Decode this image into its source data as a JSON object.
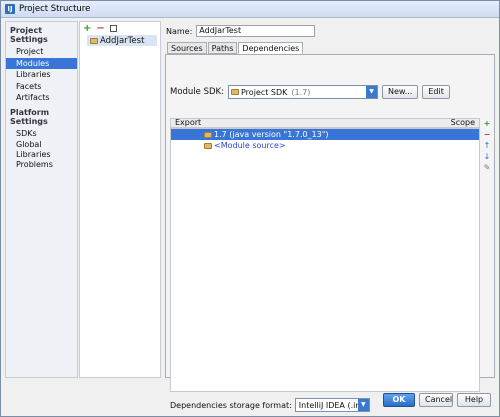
{
  "window": {
    "title": "Project Structure",
    "app_icon": "intellij-icon"
  },
  "nav": {
    "project_settings_header": "Project Settings",
    "project_items": [
      "Project",
      "Modules",
      "Libraries",
      "Facets",
      "Artifacts"
    ],
    "platform_settings_header": "Platform Settings",
    "platform_items": [
      "SDKs",
      "Global Libraries"
    ],
    "other_items": [
      "Problems"
    ],
    "selected": "Modules"
  },
  "modules": {
    "toolbar": {
      "add": "+",
      "remove": "−"
    },
    "items": [
      "AddJarTest"
    ]
  },
  "main": {
    "name_label": "Name:",
    "name_value": "AddJarTest",
    "tabs": [
      "Sources",
      "Paths",
      "Dependencies"
    ],
    "active_tab": "Dependencies",
    "sdk_label": "Module SDK:",
    "sdk_value": "Project SDK",
    "sdk_version": "(1.7)",
    "new_button": "New...",
    "edit_button": "Edit",
    "table_headers": {
      "export": "Export",
      "scope": "Scope"
    },
    "dependencies": [
      {
        "label": "1.7 (java version \"1.7.0_13\")",
        "selected": true
      },
      {
        "label": "<Module source>",
        "selected": false
      }
    ],
    "side_toolbar": {
      "add": "+",
      "remove": "−",
      "up": "↑",
      "down": "↓",
      "edit": "✎"
    },
    "storage_label": "Dependencies storage format:",
    "storage_value": "IntelliJ IDEA (.iml)"
  },
  "footer": {
    "ok": "OK",
    "cancel": "Cancel",
    "help": "Help"
  },
  "colors": {
    "accent": "#3875d7",
    "module_text": "#2b3fd4"
  }
}
